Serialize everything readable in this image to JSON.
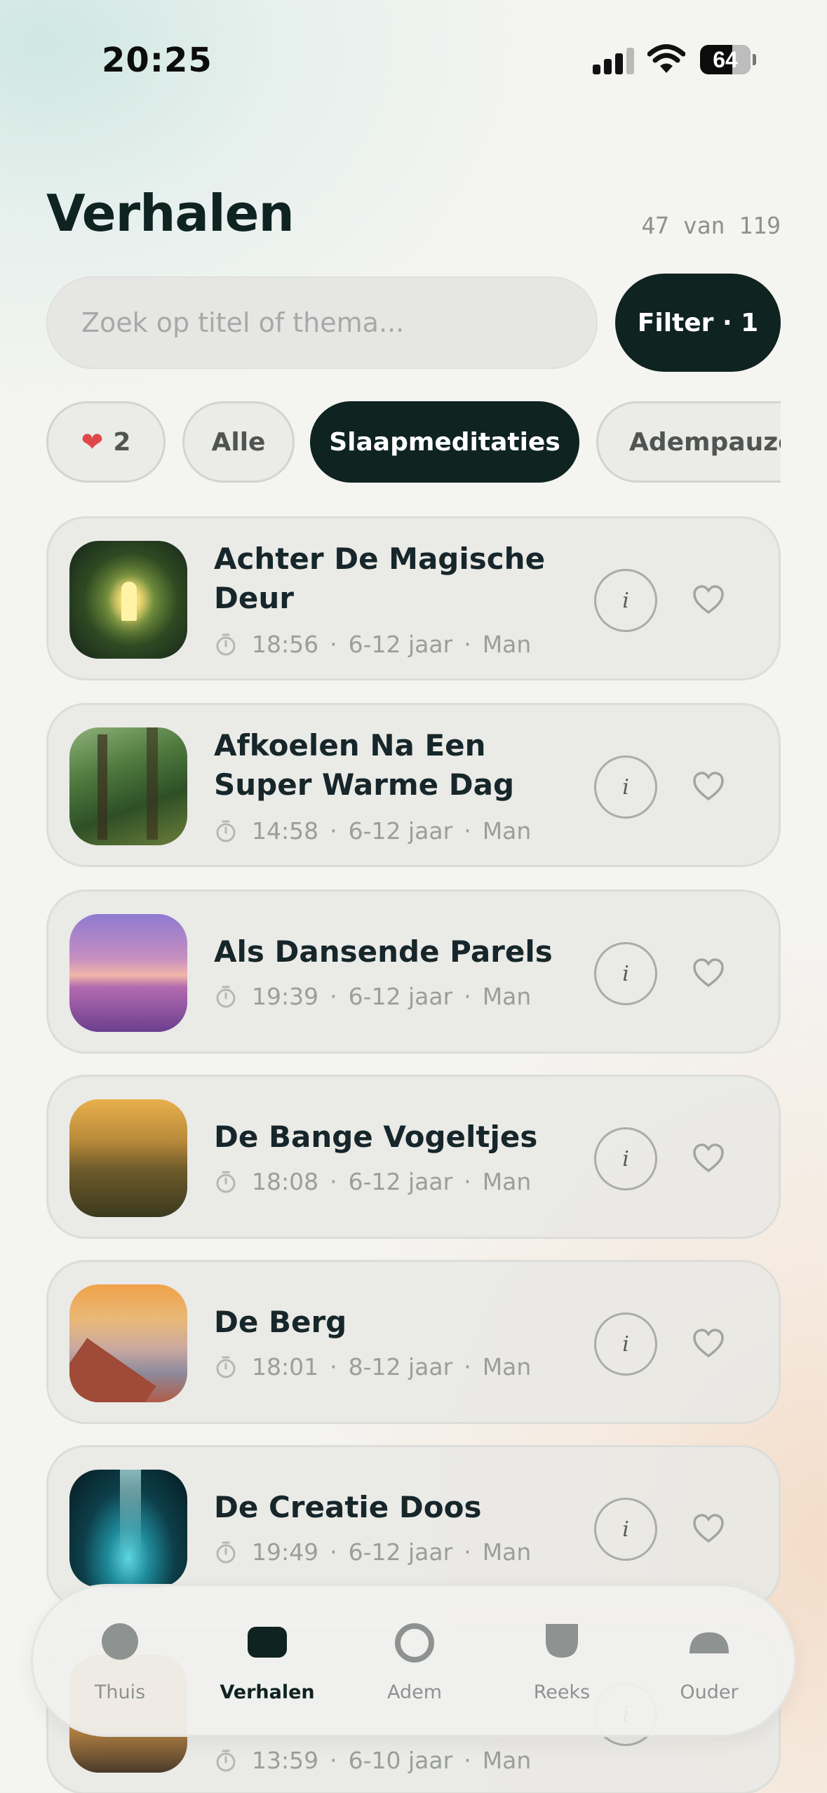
{
  "status": {
    "time": "20:25",
    "battery": "64",
    "battery_level": 0.64
  },
  "header": {
    "title": "Verhalen",
    "count": "47 van 119"
  },
  "search": {
    "placeholder": "Zoek op titel of thema..."
  },
  "filter": {
    "label": "Filter · 1"
  },
  "chips": [
    {
      "label": "2",
      "icon": "heart-icon"
    },
    {
      "label": "Alle"
    },
    {
      "label": "Slaapmeditaties",
      "active": true
    },
    {
      "label": "Adempauze"
    }
  ],
  "stories": [
    {
      "title": "Achter De Magische Deur",
      "duration": "18:56",
      "age": "6-12 jaar",
      "voice": "Man"
    },
    {
      "title": "Afkoelen Na Een Super Warme Dag",
      "duration": "14:58",
      "age": "6-12 jaar",
      "voice": "Man"
    },
    {
      "title": "Als Dansende Parels",
      "duration": "19:39",
      "age": "6-12 jaar",
      "voice": "Man"
    },
    {
      "title": "De Bange Vogeltjes",
      "duration": "18:08",
      "age": "6-12 jaar",
      "voice": "Man"
    },
    {
      "title": "De Berg",
      "duration": "18:01",
      "age": "8-12 jaar",
      "voice": "Man"
    },
    {
      "title": "De Creatie Doos",
      "duration": "19:49",
      "age": "6-12 jaar",
      "voice": "Man"
    },
    {
      "title": "",
      "duration": "13:59",
      "age": "6-10 jaar",
      "voice": "Man"
    }
  ],
  "info_label": "i",
  "tabs": [
    {
      "label": "Thuis",
      "icon": "circle-icon"
    },
    {
      "label": "Verhalen",
      "icon": "rounded-square-icon",
      "active": true
    },
    {
      "label": "Adem",
      "icon": "ring-icon"
    },
    {
      "label": "Reeks",
      "icon": "shield-icon"
    },
    {
      "label": "Ouder",
      "icon": "half-dome-icon"
    }
  ]
}
